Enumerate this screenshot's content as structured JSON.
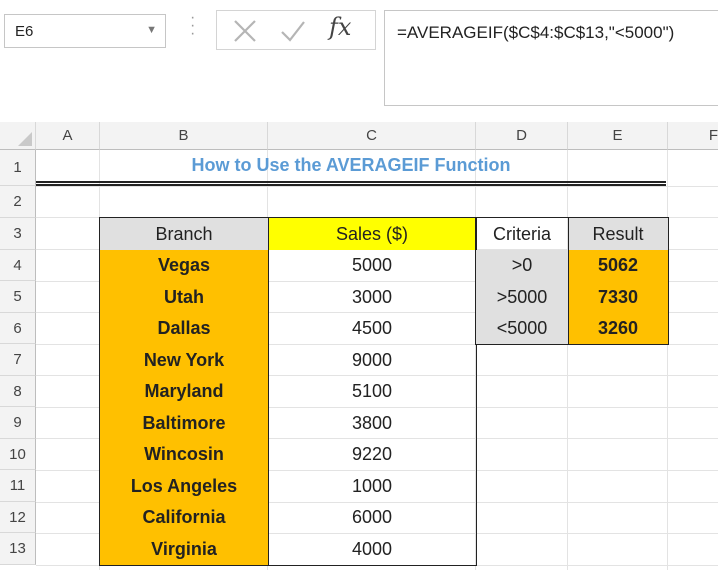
{
  "formula_bar": {
    "name_box": "E6",
    "formula": "=AVERAGEIF($C$4:$C$13,\"<5000\")",
    "fx_label": "fx"
  },
  "columns": [
    "A",
    "B",
    "C",
    "D",
    "E",
    "F"
  ],
  "rows": [
    "1",
    "2",
    "3",
    "4",
    "5",
    "6",
    "7",
    "8",
    "9",
    "10",
    "11",
    "12",
    "13"
  ],
  "title": "How to Use the AVERAGEIF Function",
  "sales_table": {
    "headers": [
      "Branch",
      "Sales ($)"
    ],
    "rows": [
      {
        "branch": "Vegas",
        "sales": "5000"
      },
      {
        "branch": "Utah",
        "sales": "3000"
      },
      {
        "branch": "Dallas",
        "sales": "4500"
      },
      {
        "branch": "New York",
        "sales": "9000"
      },
      {
        "branch": "Maryland",
        "sales": "5100"
      },
      {
        "branch": "Baltimore",
        "sales": "3800"
      },
      {
        "branch": "Wincosin",
        "sales": "9220"
      },
      {
        "branch": "Los Angeles",
        "sales": "1000"
      },
      {
        "branch": "California",
        "sales": "6000"
      },
      {
        "branch": "Virginia",
        "sales": "4000"
      }
    ]
  },
  "criteria_table": {
    "headers": [
      "Criteria",
      "Result"
    ],
    "rows": [
      {
        "criteria": ">0",
        "result": "5062"
      },
      {
        "criteria": ">5000",
        "result": "7330"
      },
      {
        "criteria": "<5000",
        "result": "3260"
      }
    ]
  },
  "colors": {
    "branch_fill": "#ffc000",
    "sales_header_fill": "#ffff00",
    "criteria_fill": "#e0e0e0",
    "title_color": "#5b9bd5"
  }
}
